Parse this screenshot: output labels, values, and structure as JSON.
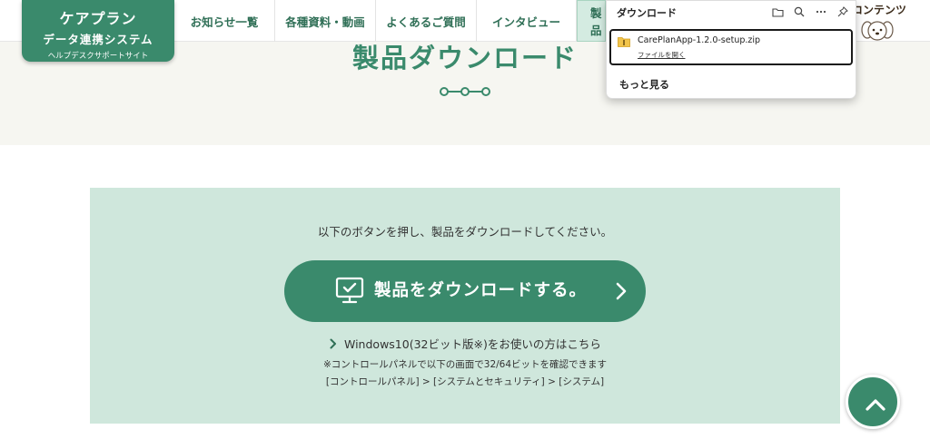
{
  "header": {
    "logo": {
      "line1": "ケアプラン",
      "line2": "データ連携システム",
      "line3": "ヘルプデスクサポートサイト"
    },
    "nav": [
      {
        "label": "お知らせ一覧",
        "active": false
      },
      {
        "label": "各種資料・動画",
        "active": false
      },
      {
        "label": "よくあるご質問",
        "active": false
      },
      {
        "label": "インタビュー",
        "active": false
      },
      {
        "label": "製品",
        "active": true
      }
    ],
    "content_link": "コンテンツ",
    "mascot_icon": "dog-mascot-icon"
  },
  "page": {
    "title": "製品ダウンロード",
    "instruction": "以下のボタンを押し、製品をダウンロードしてください。",
    "download_button": "製品をダウンロードする。",
    "win32_link": "Windows10(32ビット版※)をお使いの方はこちら",
    "note_line1": "※コントロールパネルで以下の画面で32/64ビットを確認できます",
    "note_line2": "[コントロールパネル] > [システムとセキュリティ] > [システム]"
  },
  "download_flyout": {
    "title": "ダウンロード",
    "icons": [
      "folder-icon",
      "search-icon",
      "more-icon",
      "pin-icon"
    ],
    "item": {
      "file_name": "CarePlanApp-1.2.0-setup.zip",
      "open_label": "ファイルを開く"
    },
    "more_label": "もっと見る"
  },
  "colors": {
    "brand_green": "#3a8a6c",
    "panel_bg": "#cfe7dc",
    "title_band": "#f6f6f1",
    "nav_active": "#d4ebe1"
  }
}
